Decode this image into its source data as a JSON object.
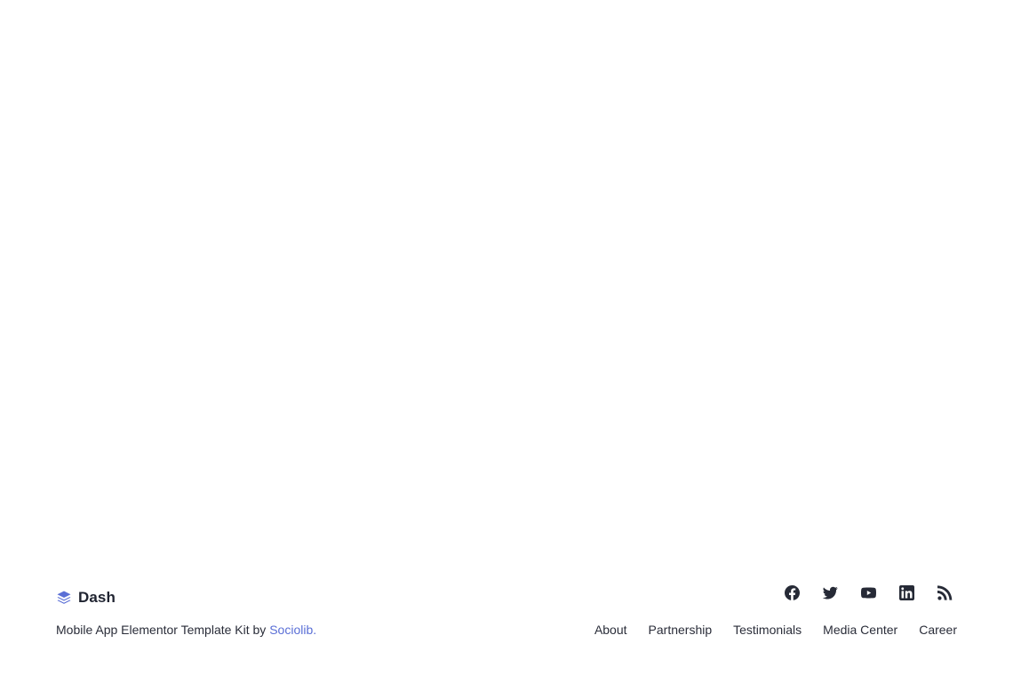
{
  "footer": {
    "brand": {
      "name": "Dash",
      "icon": "layers-icon",
      "icon_color": "#5a6fd6"
    },
    "credit": {
      "text": "Mobile App Elementor Template Kit by ",
      "link_label": "Sociolib."
    },
    "social": [
      {
        "icon": "facebook-icon"
      },
      {
        "icon": "twitter-icon"
      },
      {
        "icon": "youtube-icon"
      },
      {
        "icon": "linkedin-icon"
      },
      {
        "icon": "rss-icon"
      }
    ],
    "nav": [
      {
        "label": "About"
      },
      {
        "label": "Partnership"
      },
      {
        "label": "Testimonials"
      },
      {
        "label": "Media Center"
      },
      {
        "label": "Career"
      }
    ]
  },
  "colors": {
    "accent": "#5a6fd6",
    "text": "#1f2330",
    "background": "#ffffff"
  }
}
